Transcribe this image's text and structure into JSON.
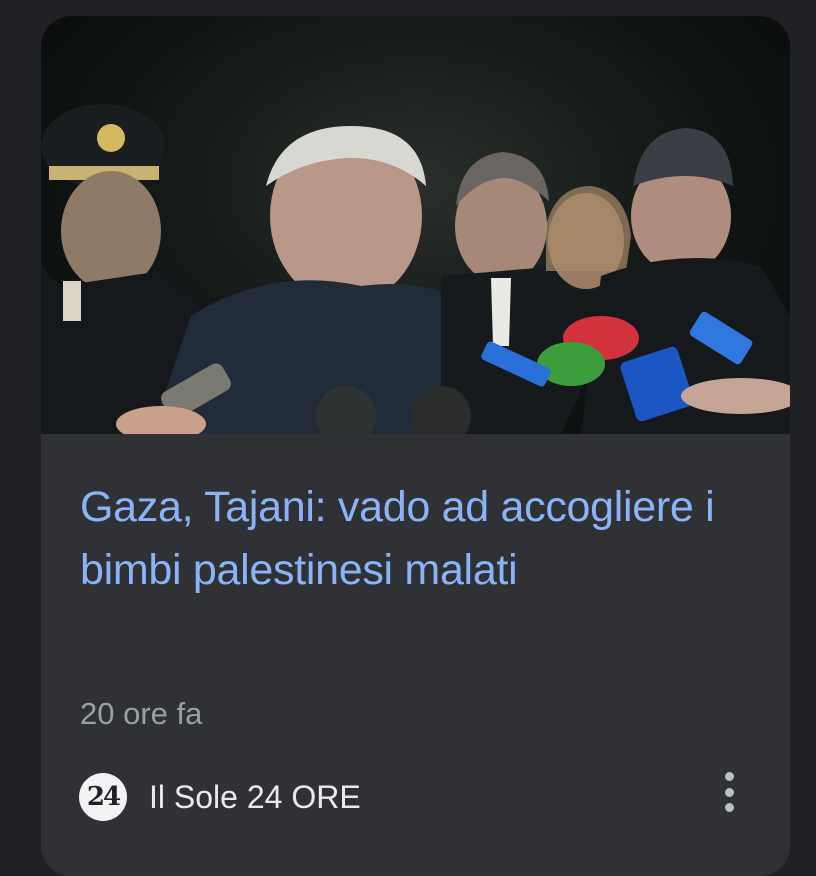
{
  "article": {
    "image_alt": "Tajani speaking to press at night",
    "headline": "Gaza, Tajani: vado ad accogliere i bimbi palestinesi malati",
    "time": "20 ore fa",
    "source": {
      "logo_text": "24",
      "name": "Il Sole 24 ORE"
    }
  },
  "colors": {
    "background": "#202124",
    "card": "#303134",
    "headline": "#8ab4f8",
    "secondary_text": "#9aa0a6"
  }
}
